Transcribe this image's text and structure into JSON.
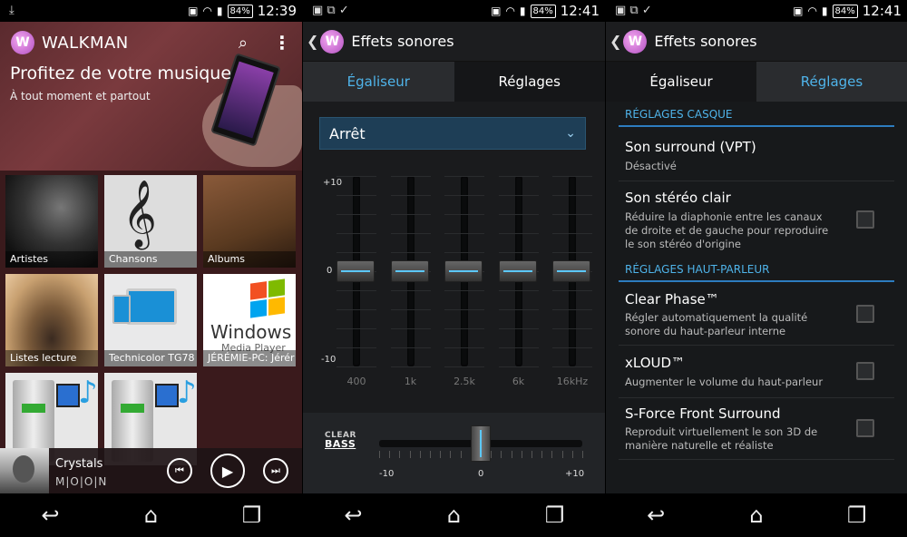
{
  "panel1": {
    "status": {
      "time": "12:39",
      "battery": "84%"
    },
    "app_title": "WALKMAN",
    "headline": "Profitez de votre musique",
    "subline": "À tout moment et partout",
    "tiles": [
      {
        "label": "Artistes"
      },
      {
        "label": "Chansons"
      },
      {
        "label": "Albums"
      },
      {
        "label": "Listes lecture"
      },
      {
        "label": "Technicolor TG78"
      },
      {
        "label": "JÉRÉMIE-PC: Jérér"
      },
      {
        "label": ""
      },
      {
        "label": ""
      }
    ],
    "wmp_text": "Windows",
    "wmp_sub": "Media Player",
    "now_playing": {
      "track": "Crystals",
      "artist": "M|O|O|N"
    }
  },
  "panel2": {
    "status": {
      "time": "12:41",
      "battery": "84%"
    },
    "title": "Effets sonores",
    "tabs": [
      {
        "label": "Égaliseur"
      },
      {
        "label": "Réglages"
      }
    ],
    "preset": "Arrêt",
    "eq_ylabels": [
      "+10",
      "0",
      "-10"
    ],
    "bands": [
      {
        "freq": "400",
        "gain": 0
      },
      {
        "freq": "1k",
        "gain": 0
      },
      {
        "freq": "2.5k",
        "gain": 0
      },
      {
        "freq": "6k",
        "gain": 0
      },
      {
        "freq": "16kHz",
        "gain": 0
      }
    ],
    "eq_range": [
      -10,
      10
    ],
    "clear_bass": {
      "logo_top": "CLEAR",
      "logo_bottom": "BASS",
      "value": 0,
      "range": [
        -10,
        10
      ],
      "labels": [
        "-10",
        "0",
        "+10"
      ]
    }
  },
  "panel3": {
    "status": {
      "time": "12:41",
      "battery": "84%"
    },
    "title": "Effets sonores",
    "tabs": [
      {
        "label": "Égaliseur"
      },
      {
        "label": "Réglages"
      }
    ],
    "section_headphones": "RÉGLAGES CASQUE",
    "section_speaker": "RÉGLAGES HAUT-PARLEUR",
    "settings": [
      {
        "title": "Son surround (VPT)",
        "desc": "Désactivé"
      },
      {
        "title": "Son stéréo clair",
        "desc": "Réduire la diaphonie entre les canaux de droite et de gauche pour reproduire le son stéréo d'origine",
        "checked": false
      },
      {
        "title": "Clear Phase™",
        "desc": "Régler automatiquement la qualité sonore du haut-parleur interne",
        "checked": false
      },
      {
        "title": "xLOUD™",
        "desc": "Augmenter le volume du haut-parleur",
        "checked": false
      },
      {
        "title": "S-Force Front Surround",
        "desc": "Reproduit virtuellement le son 3D de manière naturelle et réaliste",
        "checked": false
      }
    ]
  }
}
